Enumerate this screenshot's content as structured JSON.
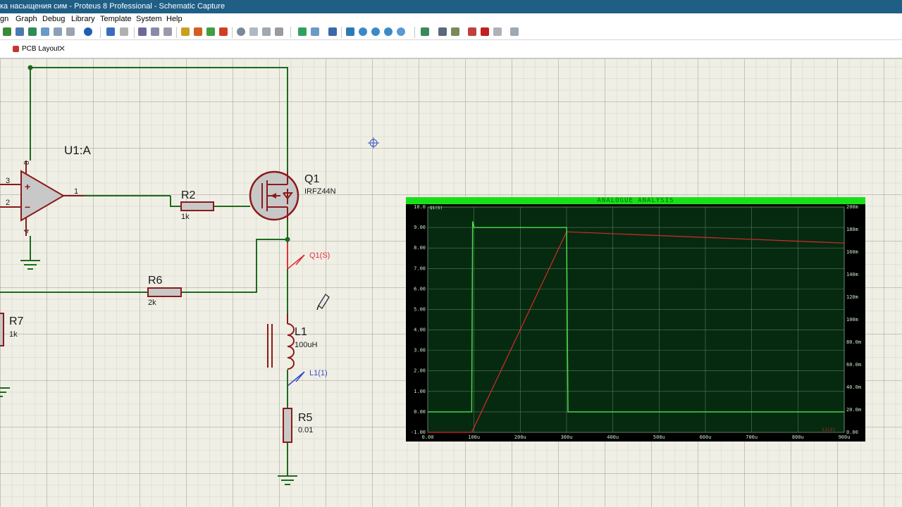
{
  "window": {
    "title": "ка насыщения сим - Proteus 8 Professional - Schematic Capture"
  },
  "menu": [
    "gn",
    "Graph",
    "Debug",
    "Library",
    "Template",
    "System",
    "Help"
  ],
  "tabs": [
    {
      "label": "PCB Layout",
      "close": "✕"
    }
  ],
  "components": {
    "u1": {
      "ref": "U1:A",
      "pin_plus": "3",
      "pin_minus": "2",
      "pin_out": "1",
      "pin_vcc": "8",
      "pin_gnd": "4",
      "plus_sign": "+",
      "minus_sign": "−"
    },
    "q1": {
      "ref": "Q1",
      "value": "IRFZ44N"
    },
    "r2": {
      "ref": "R2",
      "value": "1k"
    },
    "r6": {
      "ref": "R6",
      "value": "2k"
    },
    "r7": {
      "ref": "R7",
      "value": "1k"
    },
    "l1": {
      "ref": "L1",
      "value": "100uH"
    },
    "r5": {
      "ref": "R5",
      "value": "0.01"
    }
  },
  "probes": {
    "q1s": "Q1(S)",
    "l1": "L1(1)"
  },
  "colors": {
    "wire": "#1d6b1d",
    "component": "#8b1a1a",
    "probe_red": "#e0303a",
    "probe_blue": "#3a4ac8",
    "grid_bg": "#f0efe6",
    "graph_title_bg": "#18e018",
    "trace_green": "#4ee04e",
    "trace_red": "#d42a2a"
  },
  "graph": {
    "title": "ANALOGUE ANALYSIS",
    "trace_label": "Q1(S)",
    "left_ticks": [
      "10.0",
      "9.00",
      "8.00",
      "7.00",
      "6.00",
      "5.00",
      "4.00",
      "3.00",
      "2.00",
      "1.00",
      "0.00",
      "-1.00"
    ],
    "right_ticks": [
      "200m",
      "180m",
      "160m",
      "140m",
      "120m",
      "100m",
      "80.0m",
      "60.0m",
      "40.0m",
      "20.0m",
      "0.00"
    ],
    "x_ticks": [
      "0.00",
      "100u",
      "200u",
      "300u",
      "400u",
      "500u",
      "600u",
      "700u",
      "800u",
      "900u"
    ],
    "corner_label": "L1(1)"
  },
  "chart_data": {
    "type": "line",
    "title": "ANALOGUE ANALYSIS",
    "xlim": [
      0,
      900
    ],
    "ylim": [
      -1,
      10
    ],
    "y2lim": [
      0,
      200
    ],
    "series": [
      {
        "name": "Q1(S)",
        "axis": "left",
        "x": [
          0,
          95,
          97,
          100,
          300,
          303,
          305,
          900
        ],
        "y": [
          0,
          0,
          9.3,
          9.0,
          9.0,
          0,
          0,
          0
        ]
      },
      {
        "name": "L1(1)",
        "axis": "right",
        "x": [
          0,
          95,
          300,
          900
        ],
        "y": [
          0,
          0,
          178,
          168
        ]
      }
    ]
  }
}
